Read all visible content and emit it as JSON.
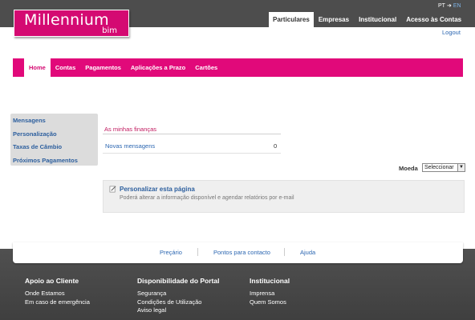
{
  "header": {
    "logo_main": "Millennium",
    "logo_sub": "bim",
    "lang_pt": "PT",
    "lang_en": "EN",
    "top_tabs": [
      {
        "label": "Particulares",
        "active": true
      },
      {
        "label": "Empresas"
      },
      {
        "label": "Institucional"
      },
      {
        "label": "Acesso às Contas"
      }
    ],
    "logout": "Logout"
  },
  "nav": {
    "items": [
      {
        "label": "Home",
        "active": true
      },
      {
        "label": "Contas"
      },
      {
        "label": "Pagamentos"
      },
      {
        "label": "Aplicações a Prazo"
      },
      {
        "label": "Cartões"
      }
    ]
  },
  "sidebar": {
    "items": [
      {
        "label": "Mensagens"
      },
      {
        "label": "Personalização"
      },
      {
        "label": "Taxas de Câmbio"
      },
      {
        "label": "Próximos Pagamentos"
      }
    ]
  },
  "finances": {
    "title": "As minhas finanças",
    "rows": [
      {
        "label": "Novas mensagens",
        "value": "0"
      }
    ]
  },
  "currency": {
    "label": "Moeda",
    "selected": "Seleccionar"
  },
  "personalize": {
    "title": "Personalizar esta página",
    "description": "Poderá alterar a informação disponível e agendar relatórios por e-mail"
  },
  "footer": {
    "links": [
      "Preçário",
      "Pontos para contacto",
      "Ajuda"
    ],
    "columns": [
      {
        "heading": "Apoio ao Cliente",
        "items": [
          "Onde Estamos",
          "Em caso de emergência"
        ]
      },
      {
        "heading": "Disponibilidade do Portal",
        "items": [
          "Segurança",
          "Condições de Utilização",
          "Aviso legal"
        ]
      },
      {
        "heading": "Institucional",
        "items": [
          "Imprensa",
          "Quem Somos"
        ]
      }
    ]
  },
  "colors": {
    "brand_pink": "#e1097a",
    "header_gray": "#4d4d4d",
    "link_blue": "#2b66b1"
  }
}
